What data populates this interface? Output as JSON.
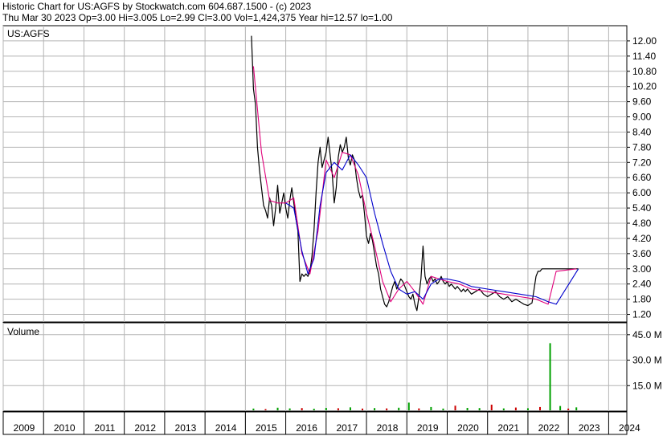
{
  "header": {
    "line1": "Historic Chart for US:AGFS by Stockwatch.com 604.687.1500 - (c) 2023",
    "line2": "Thu Mar 30 2023   Op=3.00  Hi=3.005  Lo=2.99  Cl=3.00  Vol=1,424,375   Year hi=12.57   lo=1.00"
  },
  "colors": {
    "price": "#000000",
    "ma_short": "#e0007a",
    "ma_long": "#0000cc",
    "volume_up": "#00a000",
    "volume_down": "#cc0000",
    "grid": "#b4b4b4"
  },
  "chart_data": [
    {
      "type": "line",
      "panel": "price",
      "label": "US:AGFS",
      "ylim": [
        0.9,
        12.6
      ],
      "y_ticks": [
        "12.00",
        "11.40",
        "10.80",
        "10.20",
        "9.60",
        "9.00",
        "8.40",
        "7.80",
        "7.20",
        "6.60",
        "6.00",
        "5.40",
        "4.80",
        "4.20",
        "3.60",
        "3.00",
        "2.40",
        "1.80",
        "1.20"
      ],
      "x_ticks": [
        "2009",
        "2010",
        "2011",
        "2012",
        "2013",
        "2014",
        "2015",
        "2016",
        "2017",
        "2018",
        "2019",
        "2020",
        "2021",
        "2022",
        "2023",
        "2024"
      ],
      "series": [
        {
          "role": "price",
          "x": [
            2015.15,
            2015.2,
            2015.25,
            2015.3,
            2015.35,
            2015.4,
            2015.45,
            2015.5,
            2015.55,
            2015.6,
            2015.65,
            2015.7,
            2015.75,
            2015.8,
            2015.85,
            2015.9,
            2015.95,
            2016.0,
            2016.05,
            2016.1,
            2016.15,
            2016.2,
            2016.25,
            2016.3,
            2016.35,
            2016.4,
            2016.45,
            2016.5,
            2016.55,
            2016.6,
            2016.65,
            2016.7,
            2016.75,
            2016.8,
            2016.85,
            2016.9,
            2016.95,
            2017.0,
            2017.05,
            2017.1,
            2017.15,
            2017.2,
            2017.25,
            2017.3,
            2017.35,
            2017.4,
            2017.45,
            2017.5,
            2017.55,
            2017.6,
            2017.65,
            2017.7,
            2017.75,
            2017.8,
            2017.85,
            2017.9,
            2017.95,
            2018.0,
            2018.05,
            2018.1,
            2018.15,
            2018.2,
            2018.25,
            2018.3,
            2018.35,
            2018.4,
            2018.45,
            2018.5,
            2018.55,
            2018.6,
            2018.65,
            2018.7,
            2018.75,
            2018.8,
            2018.85,
            2018.9,
            2018.95,
            2019.0,
            2019.05,
            2019.1,
            2019.15,
            2019.2,
            2019.25,
            2019.3,
            2019.35,
            2019.4,
            2019.45,
            2019.5,
            2019.55,
            2019.6,
            2019.65,
            2019.7,
            2019.75,
            2019.8,
            2019.85,
            2019.9,
            2019.95,
            2020.0,
            2020.05,
            2020.1,
            2020.15,
            2020.2,
            2020.25,
            2020.3,
            2020.35,
            2020.4,
            2020.45,
            2020.5,
            2020.6,
            2020.7,
            2020.8,
            2020.9,
            2021.0,
            2021.1,
            2021.2,
            2021.3,
            2021.4,
            2021.5,
            2021.6,
            2021.7,
            2021.8,
            2021.9,
            2022.0,
            2022.1,
            2022.2,
            2022.25,
            2022.3,
            2022.35,
            2022.4,
            2022.45,
            2022.5,
            2022.6,
            2022.8,
            2023.0,
            2023.15,
            2023.25
          ],
          "values": [
            12.2,
            10.1,
            9.5,
            7.8,
            6.9,
            6.2,
            5.5,
            5.3,
            5.0,
            5.8,
            5.5,
            4.7,
            5.4,
            6.3,
            5.2,
            5.6,
            6.0,
            5.4,
            5.0,
            5.7,
            6.2,
            5.6,
            5.0,
            4.5,
            2.5,
            2.8,
            2.7,
            2.8,
            2.7,
            2.9,
            3.5,
            4.5,
            6.0,
            7.2,
            7.8,
            7.0,
            7.3,
            7.6,
            8.2,
            7.5,
            6.8,
            5.6,
            6.2,
            7.4,
            7.9,
            7.6,
            7.8,
            8.2,
            7.4,
            7.1,
            7.5,
            7.3,
            6.6,
            6.1,
            5.8,
            5.9,
            5.2,
            4.3,
            4.0,
            4.4,
            4.1,
            3.6,
            3.1,
            2.8,
            2.2,
            1.9,
            1.6,
            1.5,
            1.7,
            2.0,
            2.3,
            2.5,
            2.2,
            2.4,
            2.6,
            2.5,
            2.3,
            2.1,
            1.9,
            1.8,
            2.0,
            1.6,
            1.35,
            1.9,
            2.6,
            3.9,
            2.7,
            2.4,
            2.6,
            2.7,
            2.5,
            2.6,
            2.4,
            2.5,
            2.7,
            2.5,
            2.4,
            2.5,
            2.3,
            2.4,
            2.3,
            2.2,
            2.3,
            2.2,
            2.1,
            2.2,
            2.1,
            2.2,
            2.0,
            2.1,
            2.2,
            2.0,
            1.9,
            2.0,
            2.1,
            1.9,
            1.8,
            1.9,
            1.7,
            1.8,
            1.7,
            1.6,
            1.55,
            1.65,
            2.7,
            2.9,
            2.9,
            3.0,
            3.0,
            3.0,
            3.0,
            3.0,
            3.0,
            3.0,
            3.0,
            3.0
          ]
        },
        {
          "role": "ma_short",
          "x": [
            2015.2,
            2015.4,
            2015.6,
            2015.8,
            2016.0,
            2016.2,
            2016.4,
            2016.6,
            2016.8,
            2017.0,
            2017.2,
            2017.4,
            2017.6,
            2017.8,
            2018.0,
            2018.2,
            2018.4,
            2018.6,
            2018.8,
            2019.0,
            2019.2,
            2019.4,
            2019.6,
            2019.8,
            2020.0,
            2020.3,
            2020.6,
            2021.0,
            2021.4,
            2021.8,
            2022.2,
            2022.5,
            2022.7,
            2023.2
          ],
          "values": [
            11.0,
            7.6,
            5.7,
            5.6,
            5.6,
            5.8,
            3.6,
            2.8,
            4.5,
            7.3,
            6.6,
            7.6,
            7.5,
            6.7,
            5.2,
            3.9,
            2.5,
            1.7,
            2.2,
            2.5,
            2.1,
            1.6,
            2.7,
            2.6,
            2.5,
            2.4,
            2.2,
            2.1,
            2.0,
            1.9,
            1.8,
            1.6,
            2.9,
            3.0
          ]
        },
        {
          "role": "ma_long",
          "x": [
            2016.0,
            2016.2,
            2016.4,
            2016.55,
            2016.7,
            2016.85,
            2017.0,
            2017.2,
            2017.4,
            2017.6,
            2017.8,
            2018.0,
            2018.2,
            2018.4,
            2018.6,
            2018.8,
            2019.0,
            2019.2,
            2019.4,
            2019.6,
            2019.8,
            2020.0,
            2020.3,
            2020.6,
            2021.0,
            2021.4,
            2021.8,
            2022.2,
            2022.5,
            2022.7,
            2023.25
          ],
          "values": [
            5.6,
            5.4,
            3.7,
            2.8,
            3.4,
            5.5,
            6.8,
            7.2,
            6.9,
            7.5,
            7.1,
            6.6,
            5.2,
            4.0,
            2.9,
            2.2,
            2.0,
            2.1,
            1.8,
            2.4,
            2.6,
            2.6,
            2.5,
            2.3,
            2.2,
            2.1,
            2.0,
            1.9,
            1.7,
            1.6,
            3.0
          ]
        }
      ]
    },
    {
      "type": "bar",
      "panel": "volume",
      "label": "Volume",
      "ylim": [
        0,
        52
      ],
      "y_ticks": [
        "45.0 M",
        "30.0 M",
        "15.0 M"
      ],
      "x": [
        2015.2,
        2015.5,
        2015.8,
        2016.1,
        2016.4,
        2016.7,
        2017.0,
        2017.3,
        2017.6,
        2017.9,
        2018.2,
        2018.5,
        2018.8,
        2019.05,
        2019.3,
        2019.6,
        2019.9,
        2020.2,
        2020.5,
        2020.8,
        2021.1,
        2021.4,
        2021.7,
        2022.0,
        2022.3,
        2022.55,
        2022.8,
        2023.0,
        2023.2
      ],
      "values": [
        1.5,
        1.2,
        2.0,
        1.6,
        1.8,
        1.4,
        1.9,
        1.7,
        2.2,
        1.5,
        1.8,
        1.6,
        2.0,
        5.0,
        1.6,
        2.4,
        1.5,
        3.2,
        1.9,
        1.8,
        3.8,
        1.6,
        2.1,
        1.7,
        2.4,
        40.0,
        3.0,
        1.5,
        2.2
      ],
      "up": [
        true,
        false,
        true,
        true,
        false,
        true,
        true,
        false,
        true,
        false,
        true,
        false,
        true,
        true,
        false,
        true,
        true,
        false,
        true,
        true,
        false,
        true,
        false,
        true,
        false,
        true,
        true,
        false,
        true
      ]
    }
  ]
}
